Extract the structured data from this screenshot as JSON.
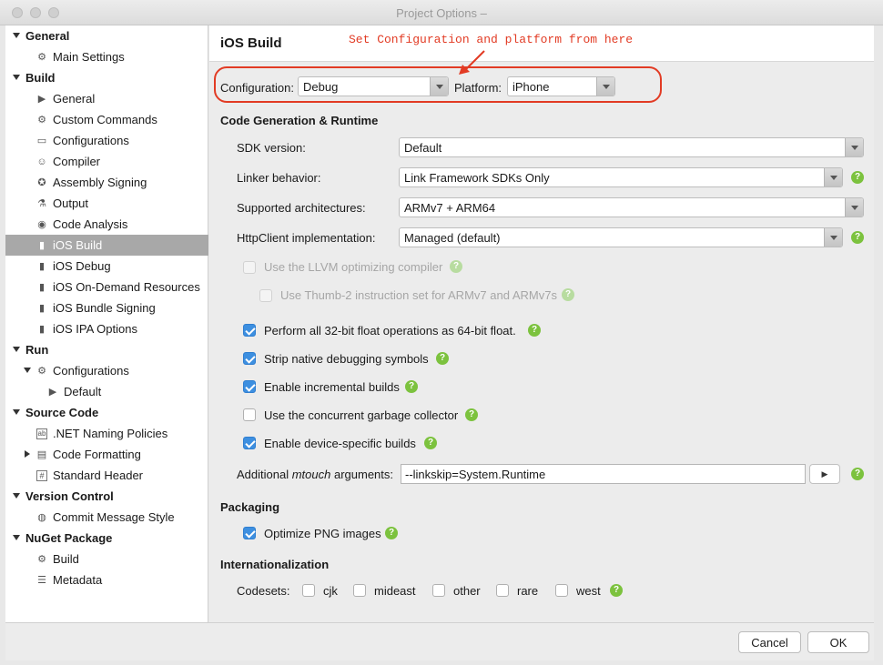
{
  "window": {
    "title": "Project Options –"
  },
  "annotation": {
    "text": "Set Configuration and platform from here",
    "color": "#e23b24"
  },
  "sidebar": {
    "items": [
      {
        "label": "General",
        "type": "category"
      },
      {
        "label": "Main Settings",
        "icon": "gear-icon"
      },
      {
        "label": "Build",
        "type": "category"
      },
      {
        "label": "General",
        "icon": "play-icon"
      },
      {
        "label": "Custom Commands",
        "icon": "gear-icon"
      },
      {
        "label": "Configurations",
        "icon": "window-icon"
      },
      {
        "label": "Compiler",
        "icon": "robot-icon"
      },
      {
        "label": "Assembly Signing",
        "icon": "badge-icon"
      },
      {
        "label": "Output",
        "icon": "flask-icon"
      },
      {
        "label": "Code Analysis",
        "icon": "target-icon"
      },
      {
        "label": "iOS Build",
        "icon": "phone-icon",
        "selected": true
      },
      {
        "label": "iOS Debug",
        "icon": "phone-icon"
      },
      {
        "label": "iOS On-Demand Resources",
        "icon": "phone-icon"
      },
      {
        "label": "iOS Bundle Signing",
        "icon": "phone-icon"
      },
      {
        "label": "iOS IPA Options",
        "icon": "phone-icon"
      },
      {
        "label": "Run",
        "type": "category"
      },
      {
        "label": "Configurations",
        "icon": "gear-icon"
      },
      {
        "label": "Default",
        "icon": "play-icon"
      },
      {
        "label": "Source Code",
        "type": "category"
      },
      {
        "label": ".NET Naming Policies",
        "icon": "ab-icon"
      },
      {
        "label": "Code Formatting",
        "icon": "document-icon"
      },
      {
        "label": "Standard Header",
        "icon": "hash-icon"
      },
      {
        "label": "Version Control",
        "type": "category"
      },
      {
        "label": "Commit Message Style",
        "icon": "globe-icon"
      },
      {
        "label": "NuGet Package",
        "type": "category"
      },
      {
        "label": "Build",
        "icon": "gear-icon"
      },
      {
        "label": "Metadata",
        "icon": "list-icon"
      }
    ]
  },
  "main": {
    "title": "iOS Build",
    "configuration": {
      "label": "Configuration:",
      "value": "Debug"
    },
    "platform": {
      "label": "Platform:",
      "value": "iPhone"
    },
    "codegen": {
      "heading": "Code Generation & Runtime",
      "sdk": {
        "label": "SDK version:",
        "value": "Default"
      },
      "linker": {
        "label": "Linker behavior:",
        "value": "Link Framework SDKs Only"
      },
      "arch": {
        "label": "Supported architectures:",
        "value": "ARMv7 + ARM64"
      },
      "httpclient": {
        "label": "HttpClient implementation:",
        "value": "Managed (default)"
      },
      "llvm": {
        "label": "Use the LLVM optimizing compiler",
        "checked": false,
        "enabled": false
      },
      "thumb": {
        "label": "Use Thumb-2 instruction set for ARMv7 and ARMv7s",
        "checked": false,
        "enabled": false
      },
      "float64": {
        "label": "Perform all 32-bit float operations as 64-bit float.",
        "checked": true
      },
      "strip": {
        "label": "Strip native debugging symbols",
        "checked": true
      },
      "incremental": {
        "label": "Enable incremental builds",
        "checked": true
      },
      "gc": {
        "label": "Use the concurrent garbage collector",
        "checked": false
      },
      "device": {
        "label": "Enable device-specific builds",
        "checked": true
      },
      "mtouch": {
        "label_prefix": "Additional ",
        "label_em": "mtouch",
        "label_suffix": " arguments:",
        "value": "--linkskip=System.Runtime"
      }
    },
    "packaging": {
      "heading": "Packaging",
      "png": {
        "label": "Optimize PNG images",
        "checked": true
      }
    },
    "i18n": {
      "heading": "Internationalization",
      "codesets_label": "Codesets:",
      "codesets": [
        "cjk",
        "mideast",
        "other",
        "rare",
        "west"
      ]
    }
  },
  "footer": {
    "cancel_label": "Cancel",
    "ok_label": "OK"
  },
  "colors": {
    "accent": "#3d8fe0",
    "help": "#7cc23e",
    "selection": "#a8a8a8",
    "annotation": "#e23b24"
  }
}
